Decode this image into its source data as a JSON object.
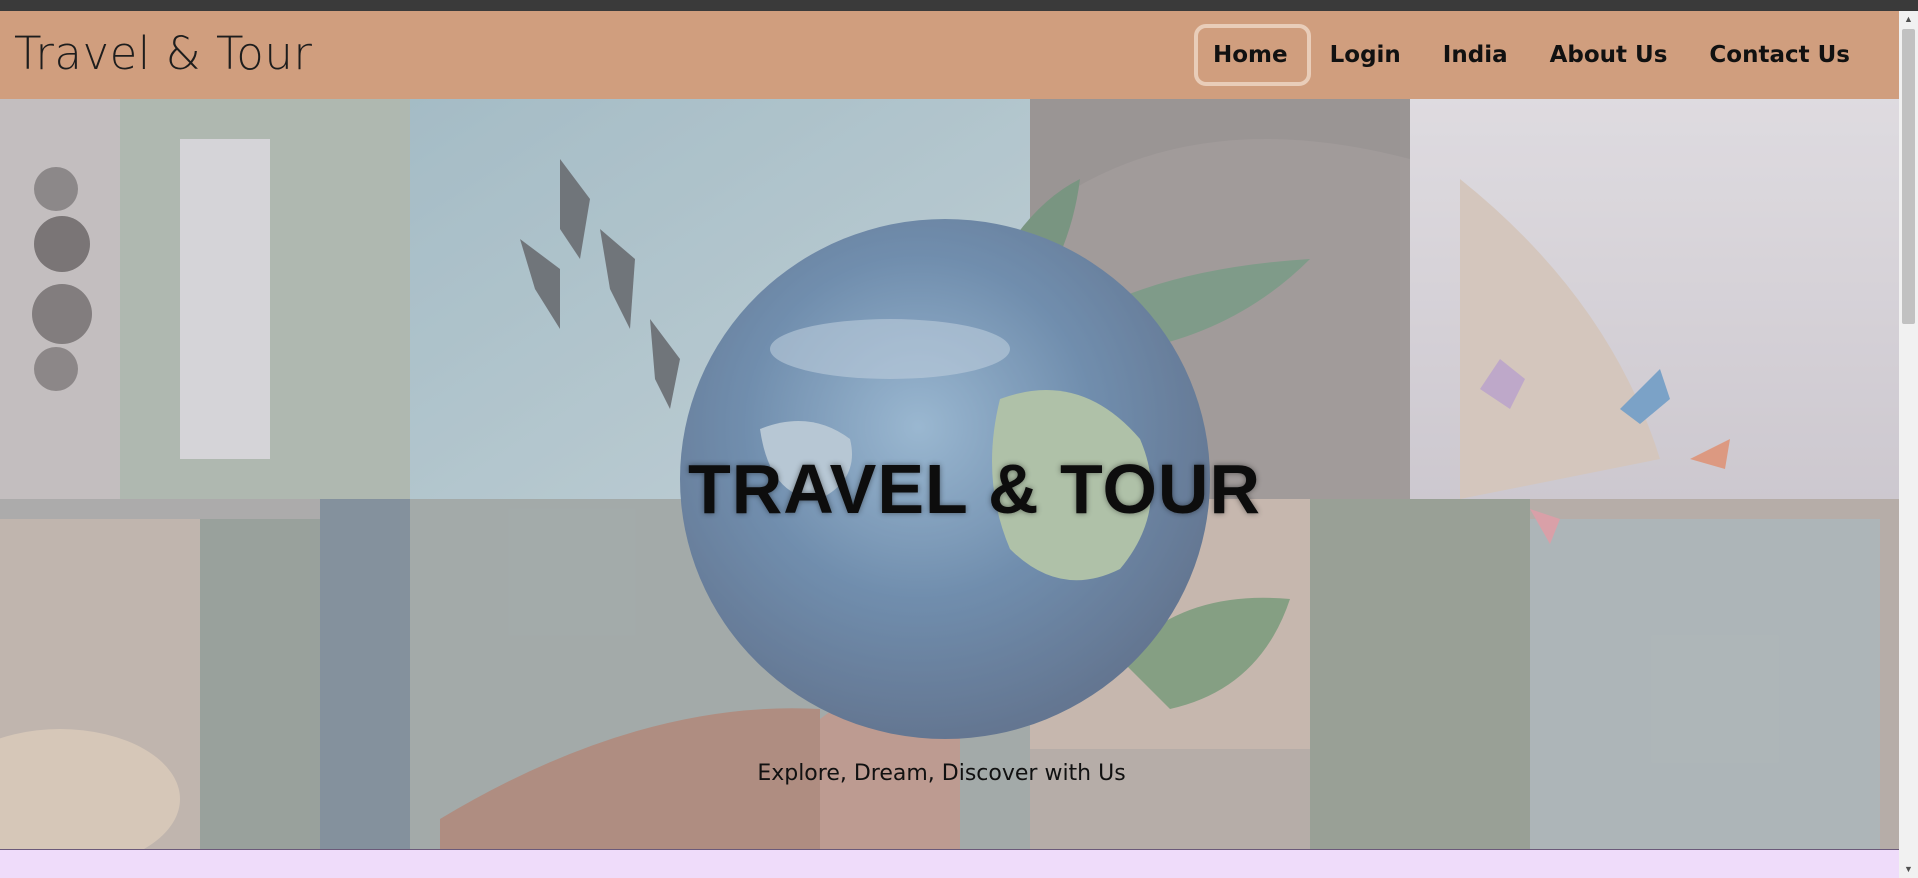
{
  "brand": "Travel & Tour",
  "nav": {
    "items": [
      {
        "label": "Home",
        "active": true
      },
      {
        "label": "Login"
      },
      {
        "label": "India"
      },
      {
        "label": "About Us"
      },
      {
        "label": "Contact Us"
      }
    ]
  },
  "hero": {
    "title": "TRAVEL & TOUR",
    "tagline": "Explore, Dream, Discover with Us"
  },
  "colors": {
    "navbar": "#d09e7e",
    "footer_strip": "#efdcfa",
    "active_outline": "#e9cdb9"
  }
}
